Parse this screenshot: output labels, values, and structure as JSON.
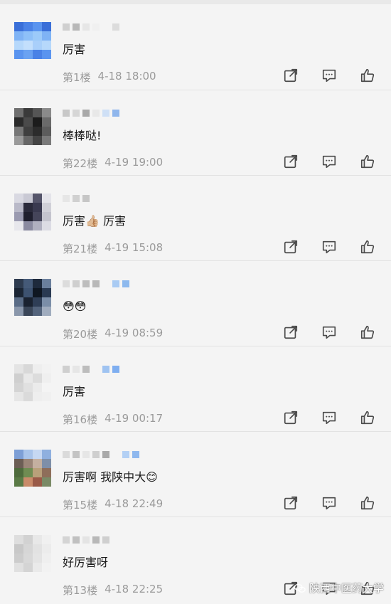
{
  "comments": [
    {
      "text": "厉害",
      "floor": "第1楼",
      "time": "4-18 18:00"
    },
    {
      "text": "棒棒哒!",
      "floor": "第22楼",
      "time": "4-19 19:00"
    },
    {
      "text": "厉害👍🏼 厉害",
      "floor": "第21楼",
      "time": "4-19 15:08"
    },
    {
      "text": "😳😳",
      "floor": "第20楼",
      "time": "4-19 08:59"
    },
    {
      "text": "厉害",
      "floor": "第16楼",
      "time": "4-19 00:17"
    },
    {
      "text": "厉害啊 我陕中大😊",
      "floor": "第15楼",
      "time": "4-18 22:49"
    },
    {
      "text": "好厉害呀",
      "floor": "第13楼",
      "time": "4-18 22:25"
    }
  ],
  "actions": {
    "share_icon": "share-icon",
    "reply_icon": "comment-icon",
    "like_icon": "thumbs-up-icon"
  },
  "watermark": {
    "text": "陕西中医药大学",
    "icon": "wechat-icon"
  },
  "colors": {
    "background": "#f4f4f4",
    "text": "#1a1a1a",
    "meta_text": "#9a9a9a",
    "icon": "#4a4a4a"
  }
}
